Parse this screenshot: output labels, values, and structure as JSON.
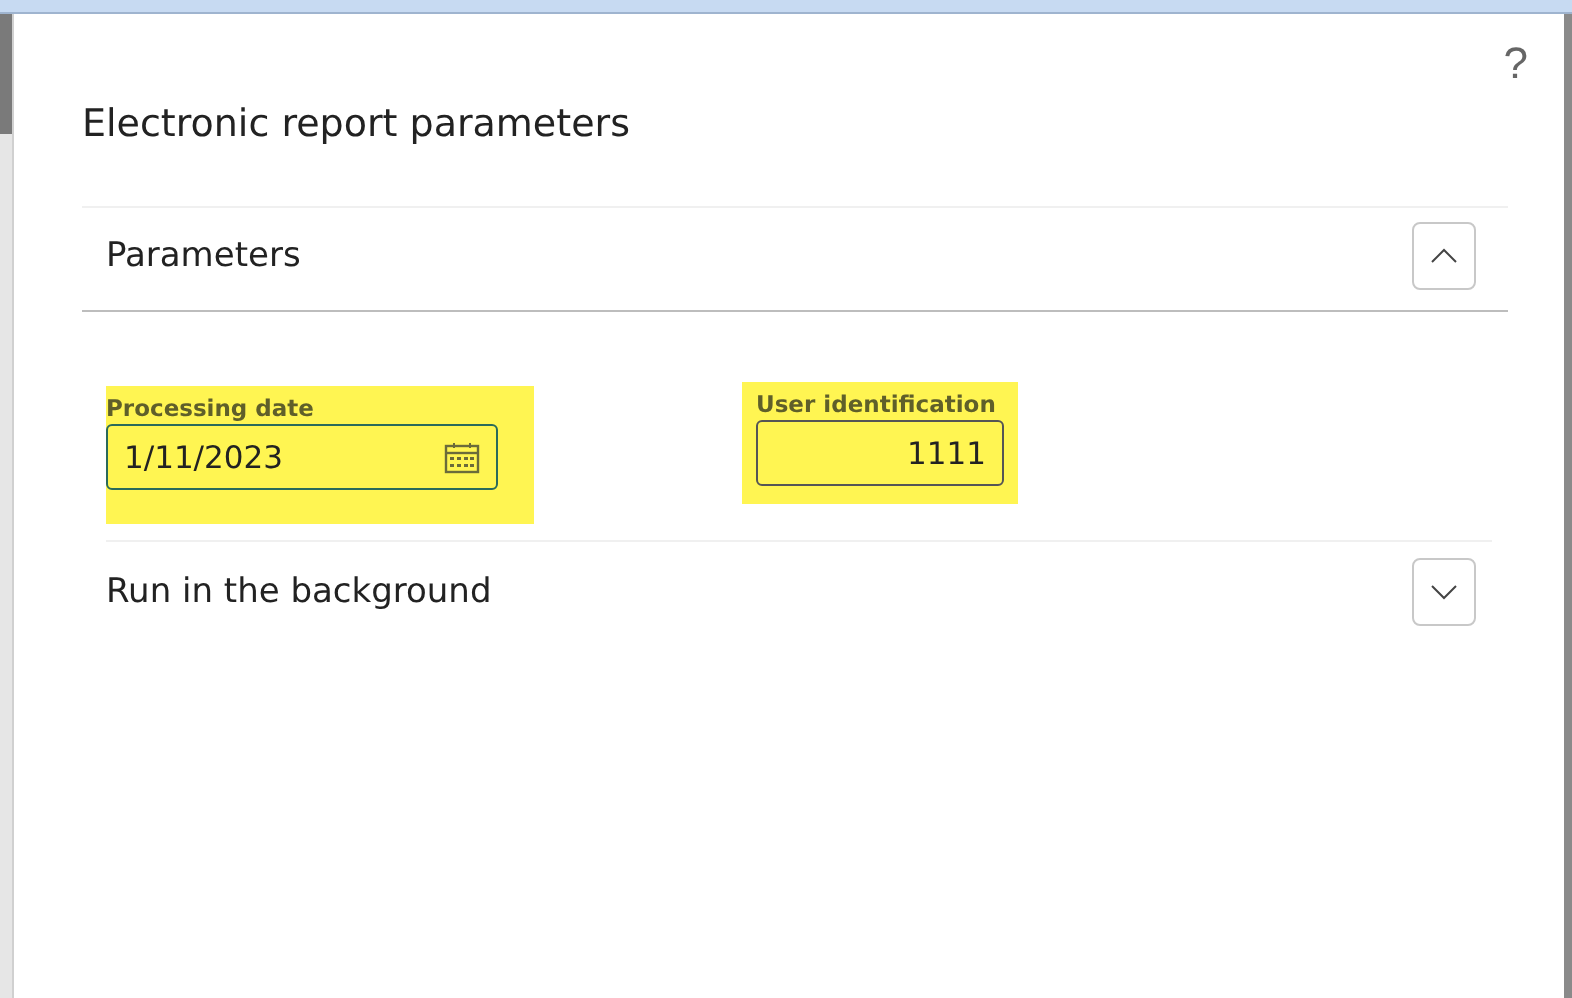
{
  "dialog": {
    "title": "Electronic report parameters",
    "help": "?"
  },
  "sections": [
    {
      "title": "Parameters",
      "expanded": true,
      "fields": [
        {
          "kind": "date",
          "label": "Processing date",
          "value": "1/11/2023",
          "highlighted": true
        },
        {
          "kind": "number",
          "label": "User identification",
          "value": "1111",
          "highlighted": true
        }
      ]
    },
    {
      "title": "Run in the background",
      "expanded": false
    }
  ]
}
